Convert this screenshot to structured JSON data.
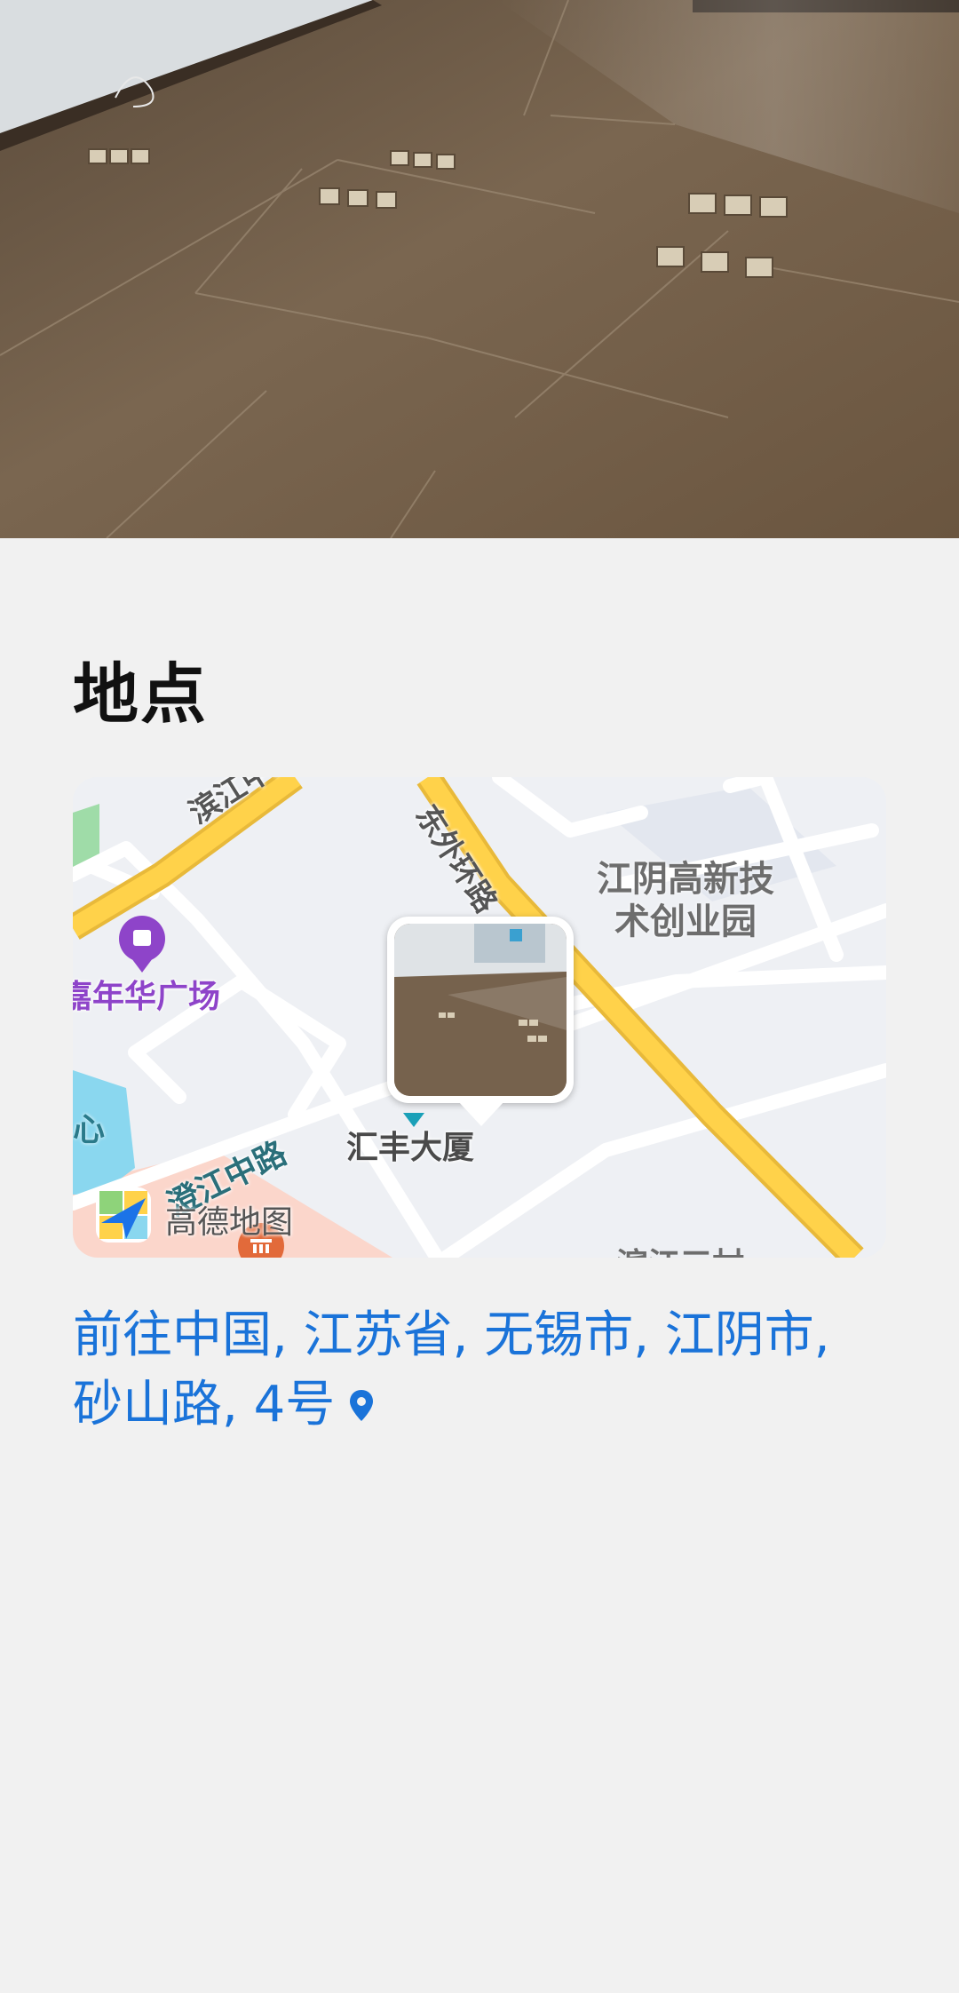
{
  "section": {
    "title": "地点"
  },
  "map": {
    "labels": {
      "binjiang_road": "滨江中路",
      "dongwai_ring": "东外环路",
      "hi_tech_park_line1": "江阴高新技",
      "hi_tech_park_line2": "术创业园",
      "carnival_plaza": "嘉年华广场",
      "xin": "心",
      "chengjiang_road": "澄江中路",
      "huifeng_building": "汇丰大厦",
      "amap": "高德地图",
      "bottom_partial": "滨江三村"
    },
    "colors": {
      "major_road": "#ffd24a",
      "minor_road": "#ffffff",
      "poi_purple": "#8e44c9",
      "water": "#7fd3f0"
    }
  },
  "address": {
    "text": "前往中国, 江苏省, 无锡市, 江阴市, 砂山路, 4号",
    "icon": "location-pin-icon"
  }
}
